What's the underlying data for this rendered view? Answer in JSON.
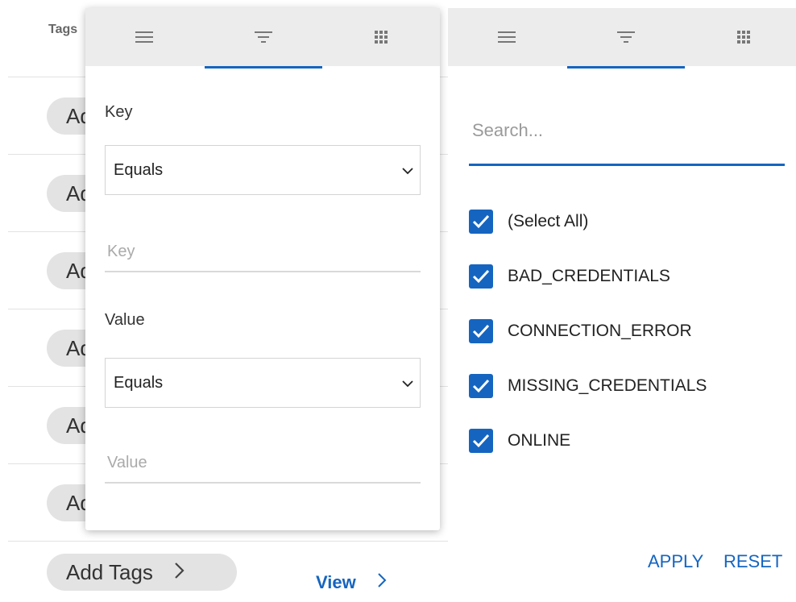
{
  "table": {
    "column_header": "Tags",
    "row_pill_text": "Add Tags",
    "add_tags_label": "Add Tags",
    "view_link": "View"
  },
  "filter_panel": {
    "key_label": "Key",
    "key_operator": "Equals",
    "key_placeholder": "Key",
    "value_label": "Value",
    "value_operator": "Equals",
    "value_placeholder": "Value"
  },
  "set_filter_panel": {
    "search_placeholder": "Search...",
    "options": [
      {
        "label": "(Select All)",
        "checked": true
      },
      {
        "label": "BAD_CREDENTIALS",
        "checked": true
      },
      {
        "label": "CONNECTION_ERROR",
        "checked": true
      },
      {
        "label": "MISSING_CREDENTIALS",
        "checked": true
      },
      {
        "label": "ONLINE",
        "checked": true
      }
    ],
    "apply_label": "APPLY",
    "reset_label": "RESET"
  },
  "colors": {
    "accent": "#1565c0",
    "tab_bar": "#ececec",
    "pill": "#e3e3e3"
  },
  "icons": [
    "menu-lines-icon",
    "filter-icon",
    "grid-icon",
    "chevron-down-icon",
    "chevron-right-icon",
    "check-icon"
  ]
}
